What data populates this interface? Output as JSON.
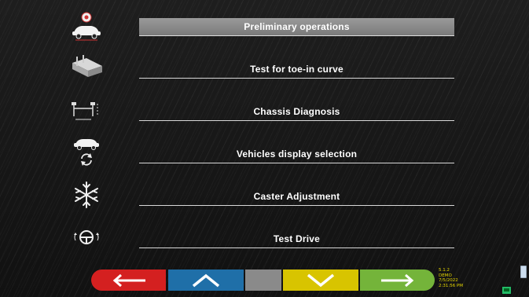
{
  "menu": {
    "items": [
      {
        "label": "Preliminary operations",
        "icon": "car-wheel-icon",
        "active": true
      },
      {
        "label": "Test for toe-in curve",
        "icon": "lift-ramp-icon",
        "active": false
      },
      {
        "label": "Chassis Diagnosis",
        "icon": "chassis-measure-icon",
        "active": false
      },
      {
        "label": "Vehicles display selection",
        "icon": "car-refresh-icon",
        "active": false
      },
      {
        "label": "Caster Adjustment",
        "icon": "snowflake-icon",
        "active": false
      },
      {
        "label": "Test Drive",
        "icon": "steering-wheel-icon",
        "active": false
      }
    ]
  },
  "nav": {
    "buttons": [
      {
        "name": "back",
        "icon": "arrow-left-icon",
        "color": "#d42020"
      },
      {
        "name": "up",
        "icon": "chevron-up-icon",
        "color": "#1f6fa8"
      },
      {
        "name": "blank",
        "icon": "",
        "color": "#8a8a8a"
      },
      {
        "name": "down",
        "icon": "chevron-down-icon",
        "color": "#d8c400"
      },
      {
        "name": "next",
        "icon": "arrow-right-icon",
        "color": "#74b43a"
      }
    ]
  },
  "status": {
    "version": "5.1.2",
    "mode": "DEMO",
    "date": "7/5/2022",
    "time": "2:31:56 PM"
  }
}
